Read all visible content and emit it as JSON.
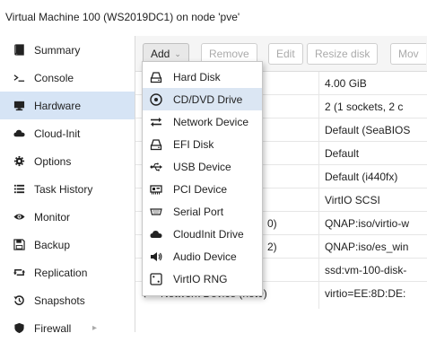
{
  "window": {
    "title": "Virtual Machine 100 (WS2019DC1) on node 'pve'"
  },
  "sidebar": {
    "items": [
      {
        "label": "Summary",
        "icon": "book-icon"
      },
      {
        "label": "Console",
        "icon": "terminal-icon"
      },
      {
        "label": "Hardware",
        "icon": "monitor-icon",
        "active": true
      },
      {
        "label": "Cloud-Init",
        "icon": "cloud-icon"
      },
      {
        "label": "Options",
        "icon": "gear-icon"
      },
      {
        "label": "Task History",
        "icon": "list-icon"
      },
      {
        "label": "Monitor",
        "icon": "eye-icon"
      },
      {
        "label": "Backup",
        "icon": "floppy-icon"
      },
      {
        "label": "Replication",
        "icon": "retweet-icon"
      },
      {
        "label": "Snapshots",
        "icon": "history-icon"
      },
      {
        "label": "Firewall",
        "icon": "shield-icon"
      }
    ]
  },
  "toolbar": {
    "add_label": "Add",
    "remove_label": "Remove",
    "edit_label": "Edit",
    "resize_label": "Resize disk",
    "move_label": "Mov"
  },
  "grid": {
    "rows": [
      {
        "key": "",
        "value": "4.00 GiB"
      },
      {
        "key": "",
        "value": "2 (1 sockets, 2 c"
      },
      {
        "key": "",
        "value": "Default (SeaBIOS"
      },
      {
        "key": "",
        "value": "Default"
      },
      {
        "key": "",
        "value": "Default (i440fx)"
      },
      {
        "key": "",
        "value": "VirtIO SCSI"
      },
      {
        "key": "0)",
        "value": "QNAP:iso/virtio-w"
      },
      {
        "key": "2)",
        "value": "QNAP:iso/es_win"
      },
      {
        "key": "",
        "value": "ssd:vm-100-disk-"
      },
      {
        "key": "Network Device (net0)",
        "value": "virtio=EE:8D:DE:"
      }
    ]
  },
  "add_menu": {
    "items": [
      {
        "label": "Hard Disk",
        "icon": "hard-disk-icon"
      },
      {
        "label": "CD/DVD Drive",
        "icon": "cd-dvd-icon",
        "hover": true
      },
      {
        "label": "Network Device",
        "icon": "network-exchange-icon"
      },
      {
        "label": "EFI Disk",
        "icon": "efi-disk-icon"
      },
      {
        "label": "USB Device",
        "icon": "usb-icon"
      },
      {
        "label": "PCI Device",
        "icon": "pci-card-icon"
      },
      {
        "label": "Serial Port",
        "icon": "serial-port-icon"
      },
      {
        "label": "CloudInit Drive",
        "icon": "cloud-icon"
      },
      {
        "label": "Audio Device",
        "icon": "speaker-icon"
      },
      {
        "label": "VirtIO RNG",
        "icon": "dice-icon"
      }
    ]
  }
}
